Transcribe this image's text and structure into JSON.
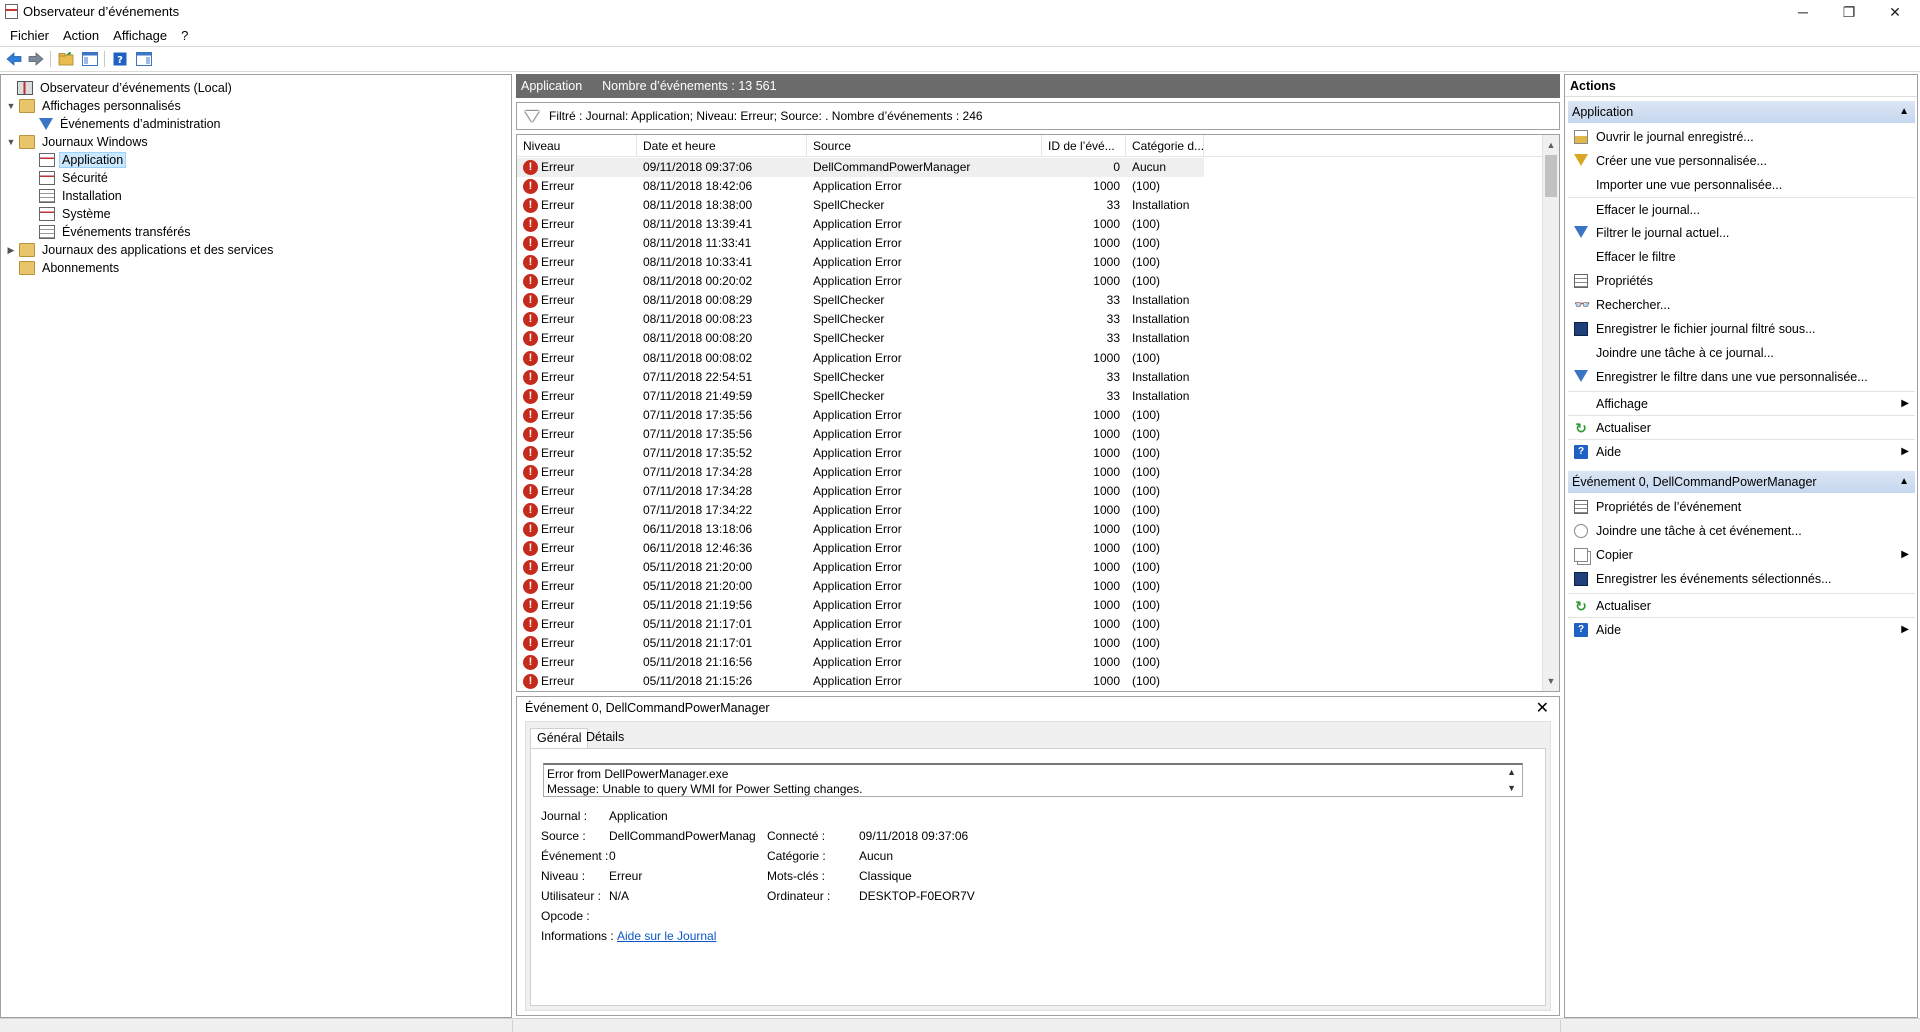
{
  "window": {
    "title": "Observateur d’événements",
    "controls": {
      "minimize": "─",
      "restore": "❐",
      "close": "✕"
    }
  },
  "menubar": {
    "items": [
      "Fichier",
      "Action",
      "Affichage",
      "?"
    ]
  },
  "toolbar": {
    "buttons": [
      "back-icon",
      "forward-icon",
      "open-folder-icon",
      "console-tree-icon",
      "help-icon",
      "action-pane-icon"
    ]
  },
  "tree": {
    "root": "Observateur d’événements (Local)",
    "custom_views": "Affichages personnalisés",
    "admin_events": "Événements d’administration",
    "windows_logs": "Journaux Windows",
    "application": "Application",
    "security": "Sécurité",
    "setup": "Installation",
    "system": "Système",
    "forwarded": "Événements transférés",
    "apps_services": "Journaux des applications et des services",
    "subscriptions": "Abonnements"
  },
  "center": {
    "log_name": "Application",
    "event_count": "Nombre d’événements : 13 561"
  },
  "filter": {
    "text": "Filtré : Journal: Application; Niveau: Erreur; Source: . Nombre d’événements : 246"
  },
  "grid": {
    "columns": [
      "Niveau",
      "Date et heure",
      "Source",
      "ID de l’évé...",
      "Catégorie d..."
    ],
    "rows": [
      [
        "Erreur",
        "09/11/2018 09:37:06",
        "DellCommandPowerManager",
        "0",
        "Aucun"
      ],
      [
        "Erreur",
        "08/11/2018 18:42:06",
        "Application Error",
        "1000",
        "(100)"
      ],
      [
        "Erreur",
        "08/11/2018 18:38:00",
        "SpellChecker",
        "33",
        "Installation"
      ],
      [
        "Erreur",
        "08/11/2018 13:39:41",
        "Application Error",
        "1000",
        "(100)"
      ],
      [
        "Erreur",
        "08/11/2018 11:33:41",
        "Application Error",
        "1000",
        "(100)"
      ],
      [
        "Erreur",
        "08/11/2018 10:33:41",
        "Application Error",
        "1000",
        "(100)"
      ],
      [
        "Erreur",
        "08/11/2018 00:20:02",
        "Application Error",
        "1000",
        "(100)"
      ],
      [
        "Erreur",
        "08/11/2018 00:08:29",
        "SpellChecker",
        "33",
        "Installation"
      ],
      [
        "Erreur",
        "08/11/2018 00:08:23",
        "SpellChecker",
        "33",
        "Installation"
      ],
      [
        "Erreur",
        "08/11/2018 00:08:20",
        "SpellChecker",
        "33",
        "Installation"
      ],
      [
        "Erreur",
        "08/11/2018 00:08:02",
        "Application Error",
        "1000",
        "(100)"
      ],
      [
        "Erreur",
        "07/11/2018 22:54:51",
        "SpellChecker",
        "33",
        "Installation"
      ],
      [
        "Erreur",
        "07/11/2018 21:49:59",
        "SpellChecker",
        "33",
        "Installation"
      ],
      [
        "Erreur",
        "07/11/2018 17:35:56",
        "Application Error",
        "1000",
        "(100)"
      ],
      [
        "Erreur",
        "07/11/2018 17:35:56",
        "Application Error",
        "1000",
        "(100)"
      ],
      [
        "Erreur",
        "07/11/2018 17:35:52",
        "Application Error",
        "1000",
        "(100)"
      ],
      [
        "Erreur",
        "07/11/2018 17:34:28",
        "Application Error",
        "1000",
        "(100)"
      ],
      [
        "Erreur",
        "07/11/2018 17:34:28",
        "Application Error",
        "1000",
        "(100)"
      ],
      [
        "Erreur",
        "07/11/2018 17:34:22",
        "Application Error",
        "1000",
        "(100)"
      ],
      [
        "Erreur",
        "06/11/2018 13:18:06",
        "Application Error",
        "1000",
        "(100)"
      ],
      [
        "Erreur",
        "06/11/2018 12:46:36",
        "Application Error",
        "1000",
        "(100)"
      ],
      [
        "Erreur",
        "05/11/2018 21:20:00",
        "Application Error",
        "1000",
        "(100)"
      ],
      [
        "Erreur",
        "05/11/2018 21:20:00",
        "Application Error",
        "1000",
        "(100)"
      ],
      [
        "Erreur",
        "05/11/2018 21:19:56",
        "Application Error",
        "1000",
        "(100)"
      ],
      [
        "Erreur",
        "05/11/2018 21:17:01",
        "Application Error",
        "1000",
        "(100)"
      ],
      [
        "Erreur",
        "05/11/2018 21:17:01",
        "Application Error",
        "1000",
        "(100)"
      ],
      [
        "Erreur",
        "05/11/2018 21:16:56",
        "Application Error",
        "1000",
        "(100)"
      ],
      [
        "Erreur",
        "05/11/2018 21:15:26",
        "Application Error",
        "1000",
        "(100)"
      ]
    ]
  },
  "detail": {
    "title": "Événement 0, DellCommandPowerManager",
    "tabs": [
      "Général",
      "Détails"
    ],
    "message_line1": "Error from DellPowerManager.exe",
    "message_line2": "Message: Unable to query WMI for Power Setting changes.",
    "labels": {
      "journal": "Journal :",
      "source": "Source :",
      "event": "Événement :",
      "level": "Niveau :",
      "user": "Utilisateur :",
      "opcode": "Opcode :",
      "info": "Informations :",
      "logged": "Connecté :",
      "category": "Catégorie :",
      "keywords": "Mots-clés :",
      "computer": "Ordinateur :"
    },
    "values": {
      "journal": "Application",
      "source": "DellCommandPowerManager",
      "event": "0",
      "level": "Erreur",
      "user": "N/A",
      "opcode": "",
      "info_link": "Aide sur le Journal",
      "logged": "09/11/2018 09:37:06",
      "category": "Aucun",
      "keywords": "Classique",
      "computer": "DESKTOP-F0EOR7V"
    }
  },
  "actions": {
    "header": "Actions",
    "section1": {
      "title": "Application",
      "items": [
        "Ouvrir le journal enregistré...",
        "Créer une vue personnalisée...",
        "Importer une vue personnalisée...",
        "Effacer le journal...",
        "Filtrer le journal actuel...",
        "Effacer le filtre",
        "Propriétés",
        "Rechercher...",
        "Enregistrer le fichier journal filtré sous...",
        "Joindre une tâche à ce journal...",
        "Enregistrer le filtre dans une vue personnalisée...",
        "Affichage",
        "Actualiser",
        "Aide"
      ]
    },
    "section2": {
      "title": "Événement 0, DellCommandPowerManager",
      "items": [
        "Propriétés de l’événement",
        "Joindre une tâche à cet événement...",
        "Copier",
        "Enregistrer les événements sélectionnés...",
        "Actualiser",
        "Aide"
      ]
    }
  },
  "colors": {
    "header_bg": "#6b6b6b",
    "selection": "#cce8ff",
    "error_red": "#c42b1c",
    "section_bg": "#c6d7ee",
    "link": "#0b57c8"
  }
}
